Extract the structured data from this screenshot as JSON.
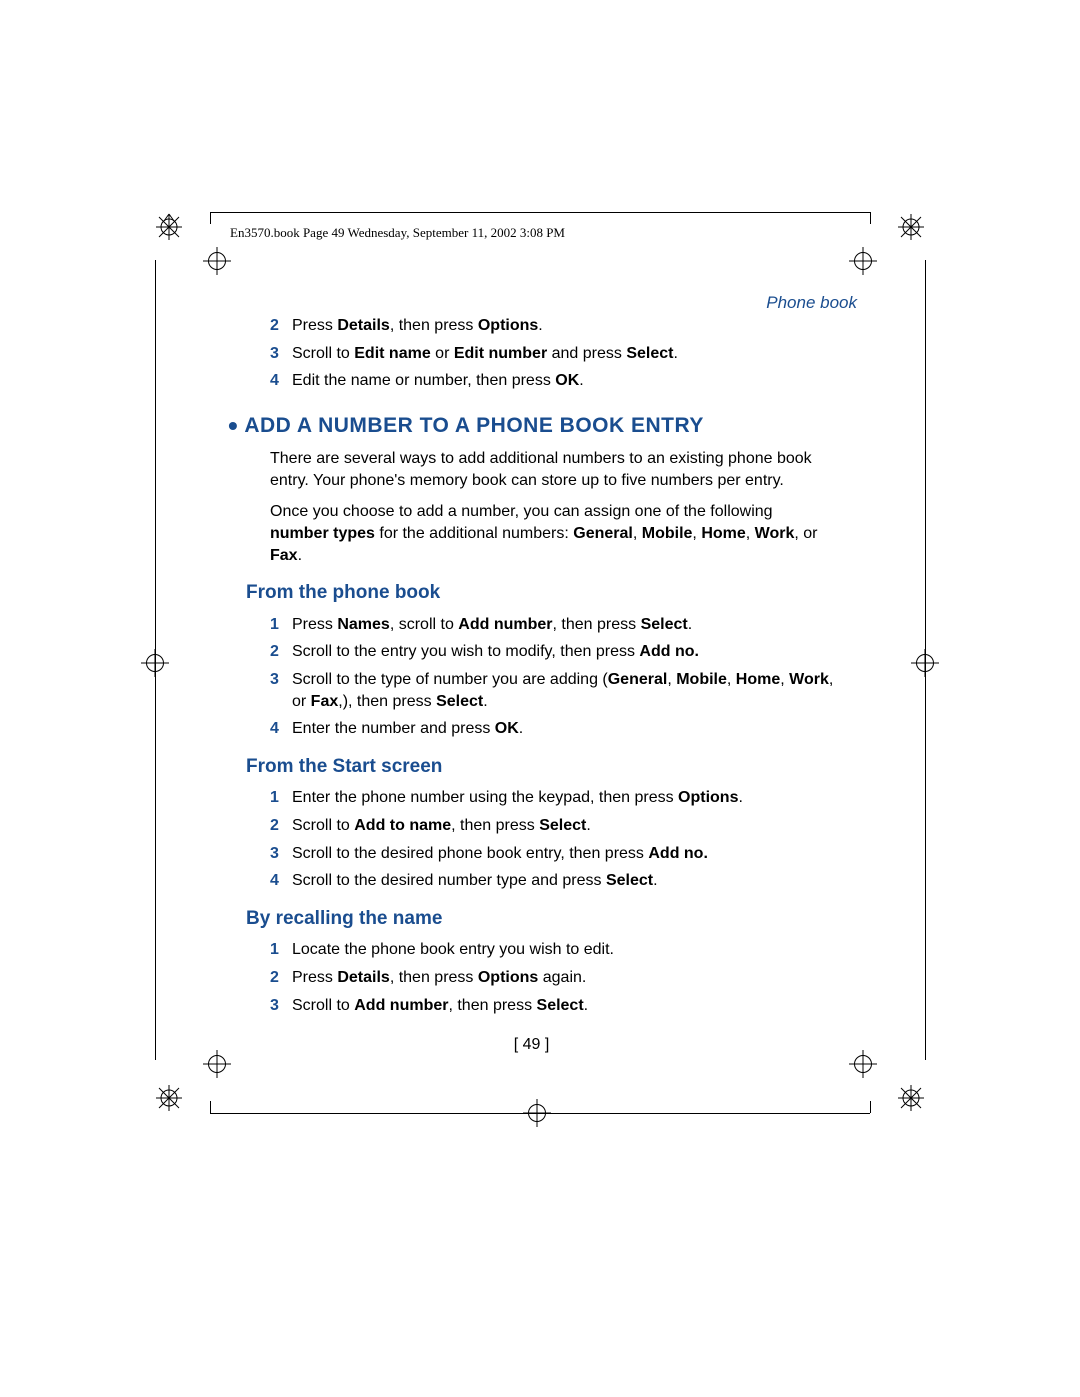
{
  "header": "En3570.book  Page 49  Wednesday, September 11, 2002  3:08 PM",
  "section_label": "Phone book",
  "top_steps": [
    {
      "n": "2",
      "html": "Press <b>Details</b>, then press <b>Options</b>."
    },
    {
      "n": "3",
      "html": "Scroll to <b>Edit name</b> or <b>Edit number</b> and press <b>Select</b>."
    },
    {
      "n": "4",
      "html": "Edit the name or number, then press <b>OK</b>."
    }
  ],
  "title": "ADD A NUMBER TO A PHONE BOOK ENTRY",
  "para1": "There are several ways to add additional numbers to an existing phone book entry. Your phone's memory book can store up to five numbers per entry.",
  "para2_pre": "Once you choose to add a number, you can assign one of the following ",
  "para2_bold1": "number types",
  "para2_mid": " for the additional numbers: ",
  "para2_bold2": "General",
  "para2_bold3": "Mobile",
  "para2_bold4": "Home",
  "para2_bold5": "Work",
  "para2_bold6": "Fax",
  "sections": [
    {
      "title": "From the phone book",
      "steps": [
        {
          "n": "1",
          "html": "Press <b>Names</b>, scroll to <b>Add number</b>, then press <b>Select</b>."
        },
        {
          "n": "2",
          "html": "Scroll to the entry you wish to modify, then press <b>Add no.</b>"
        },
        {
          "n": "3",
          "html": "Scroll to the type of number you are adding (<b>General</b>, <b>Mobile</b>, <b>Home</b>, <b>Work</b>, or <b>Fax</b>,), then press <b>Select</b>."
        },
        {
          "n": "4",
          "html": "Enter the number and press <b>OK</b>."
        }
      ]
    },
    {
      "title": "From the Start screen",
      "steps": [
        {
          "n": "1",
          "html": "Enter the phone number using the keypad, then press <b>Options</b>."
        },
        {
          "n": "2",
          "html": "Scroll to <b>Add to name</b>, then press <b>Select</b>."
        },
        {
          "n": "3",
          "html": "Scroll to the desired phone book entry, then press <b>Add no.</b>"
        },
        {
          "n": "4",
          "html": "Scroll to the desired number type and press <b>Select</b>."
        }
      ]
    },
    {
      "title": "By recalling the name",
      "steps": [
        {
          "n": "1",
          "html": "Locate the phone book entry you wish to edit."
        },
        {
          "n": "2",
          "html": "Press <b>Details</b>, then press <b>Options</b> again."
        },
        {
          "n": "3",
          "html": "Scroll to <b>Add number</b>, then press <b>Select</b>."
        }
      ]
    }
  ],
  "page_number": "[ 49 ]"
}
